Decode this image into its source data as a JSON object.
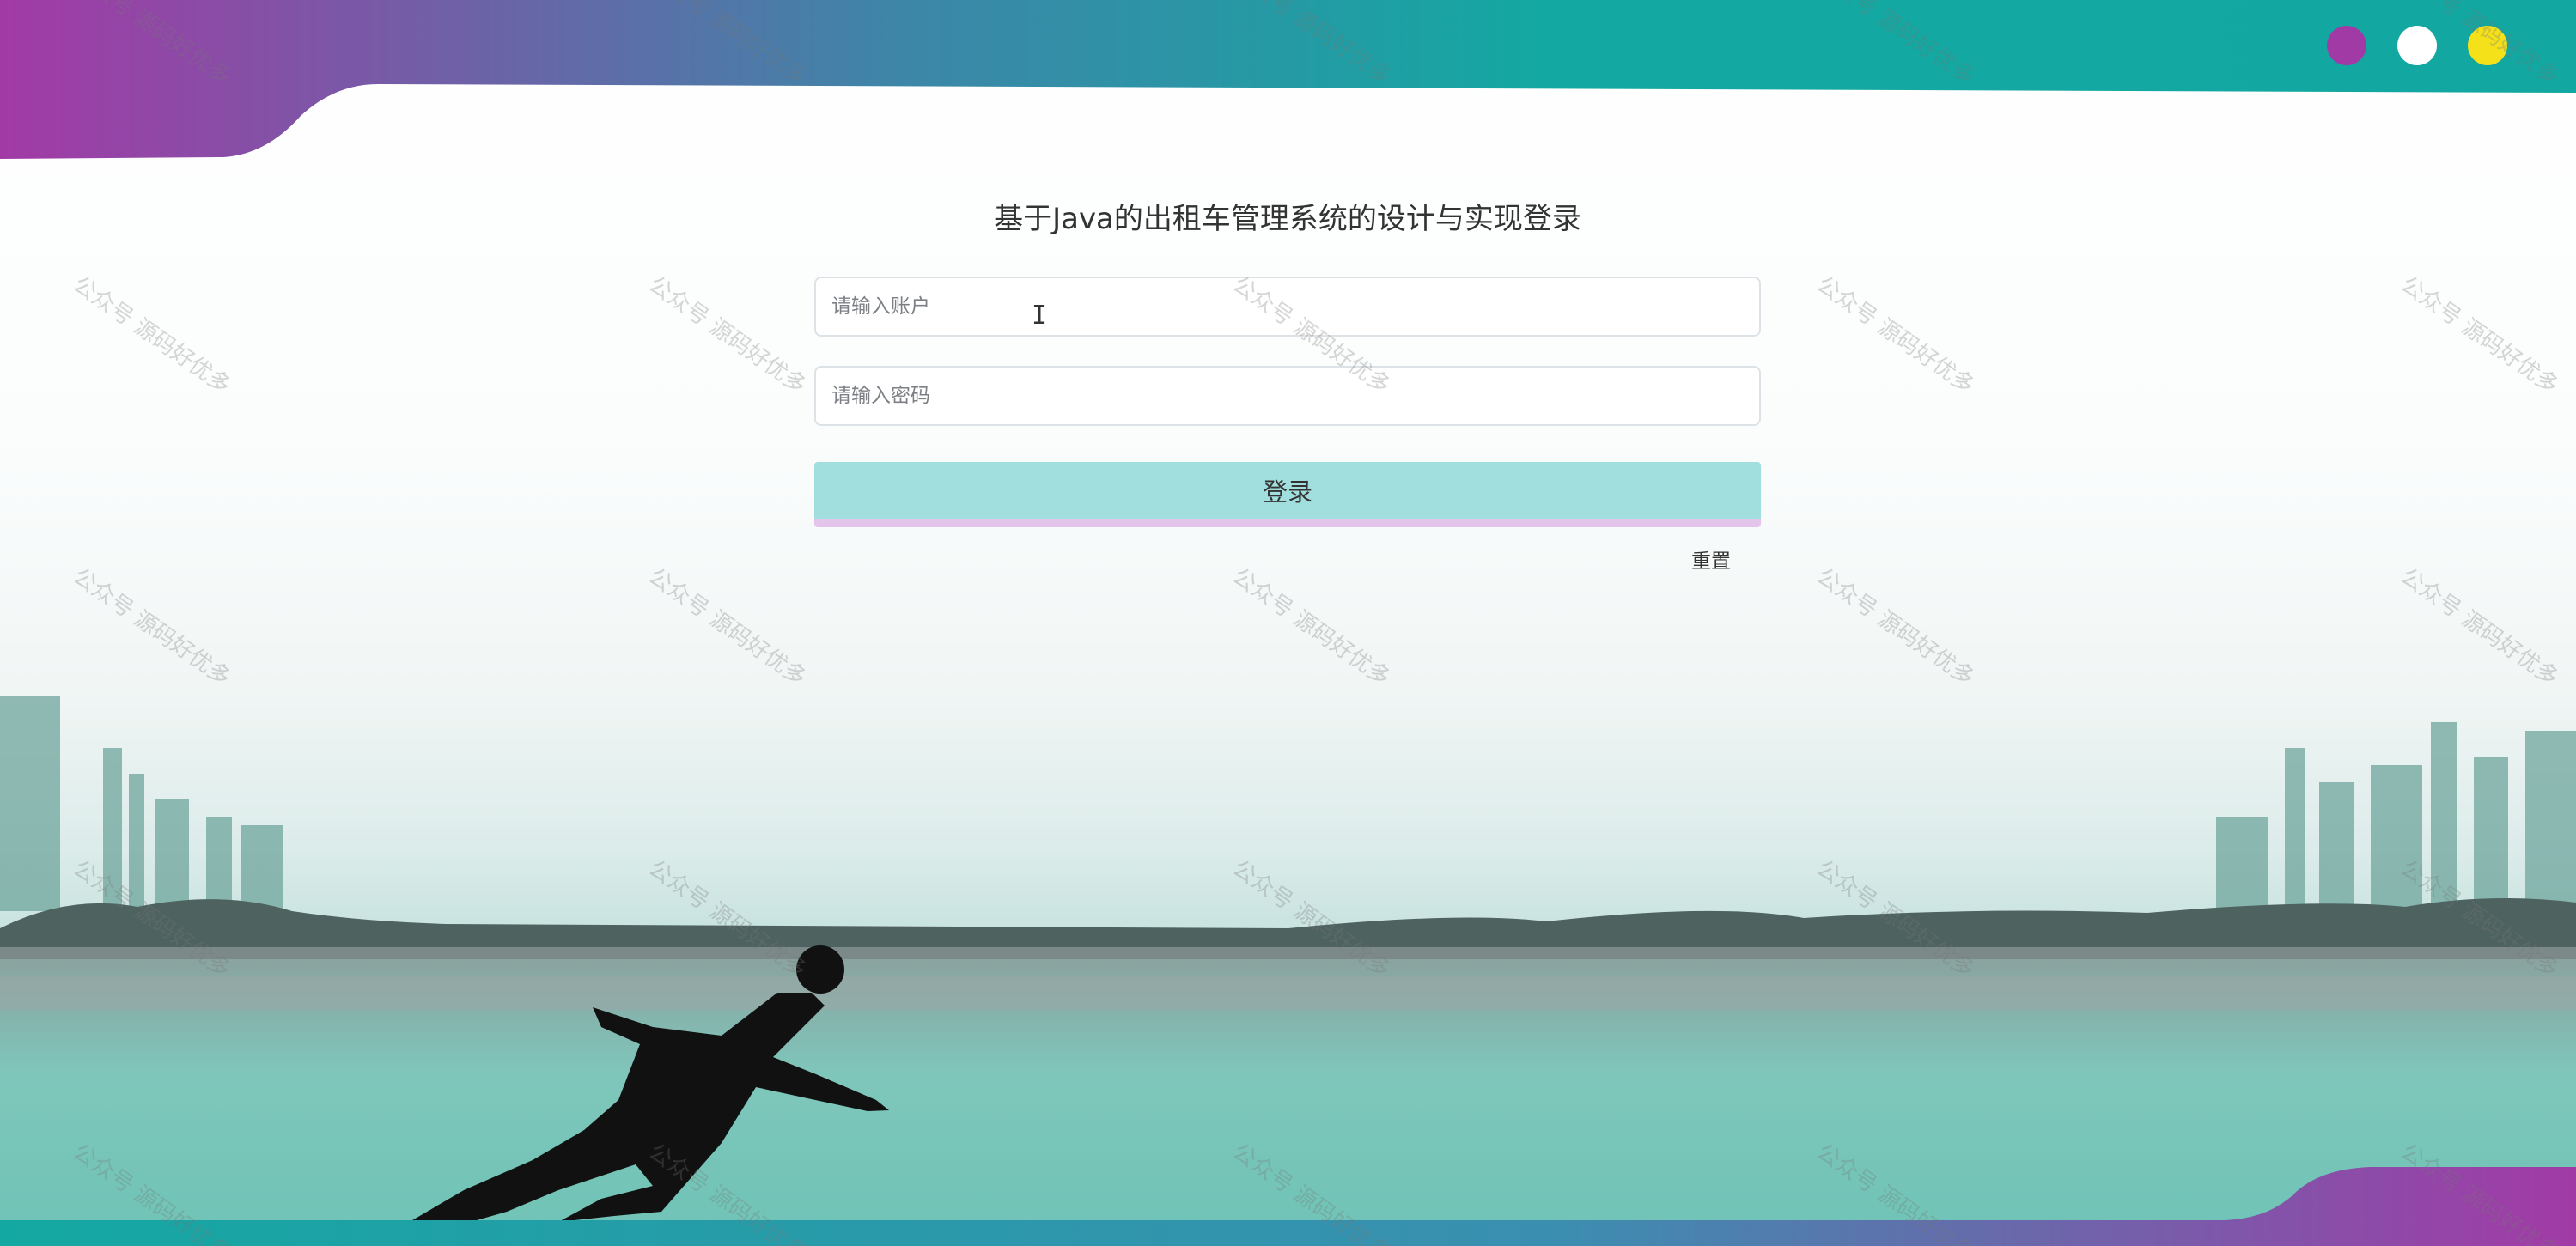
{
  "window": {
    "dots": [
      {
        "name": "purple-dot",
        "color": "#a23aa6"
      },
      {
        "name": "white-dot",
        "color": "#ffffff"
      },
      {
        "name": "yellow-dot",
        "color": "#f4e11a"
      }
    ]
  },
  "login": {
    "title": "基于Java的出租车管理系统的设计与实现登录",
    "account_placeholder": "请输入账户",
    "account_value": "",
    "password_placeholder": "请输入密码",
    "password_value": "",
    "login_label": "登录",
    "reset_label": "重置"
  },
  "watermark": {
    "text": "公众号 源码好优多"
  },
  "colors": {
    "banner_purple": "#a23aa6",
    "banner_teal": "#14a8a2",
    "button_bg": "#a1dede",
    "button_border": "#e3c5ec"
  }
}
